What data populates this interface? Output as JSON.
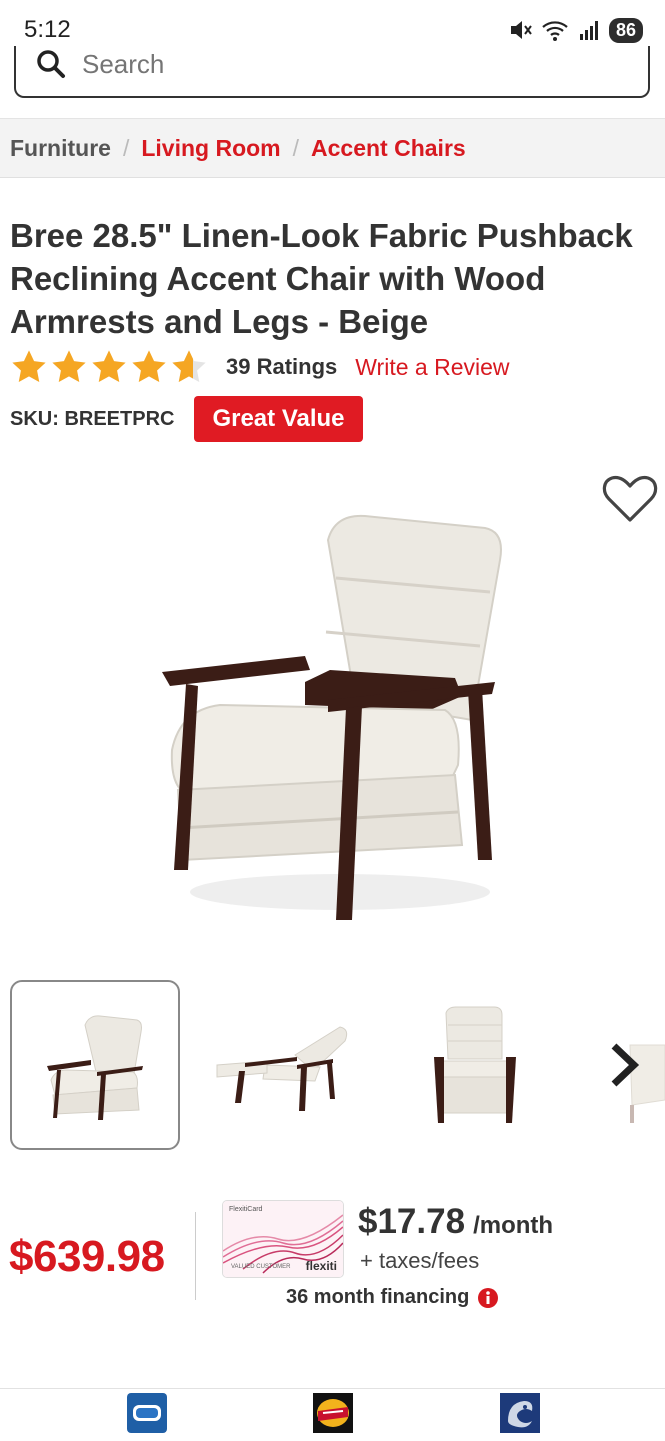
{
  "status_bar": {
    "time": "5:12",
    "battery": "86"
  },
  "search": {
    "placeholder": "Search"
  },
  "breadcrumb": {
    "root": "Furniture",
    "level2": "Living Room",
    "level3": "Accent Chairs"
  },
  "product": {
    "title": "Bree 28.5\" Linen-Look Fabric Pushback Reclining Accent Chair with Wood Armrests and Legs - Beige",
    "rating": 4.6,
    "ratings_count": "39 Ratings",
    "write_review": "Write a Review",
    "sku": "SKU: BREETPRC",
    "badge": "Great Value"
  },
  "pricing": {
    "price": "$639.98",
    "monthly_price": "$17.78",
    "monthly_unit": "/month",
    "taxes": "+ taxes/fees",
    "financing": "36 month financing",
    "card": {
      "label": "FlexitiCard",
      "holder": "VALUED CUSTOMER",
      "brand": "flexiti"
    }
  },
  "icons": {
    "wishlist": "heart-outline-icon",
    "next": "chevron-right-icon",
    "info": "info-icon",
    "star": "star-icon"
  },
  "colors": {
    "brand_red": "#d71920",
    "star": "#f5a623",
    "badge": "#e01b23"
  }
}
